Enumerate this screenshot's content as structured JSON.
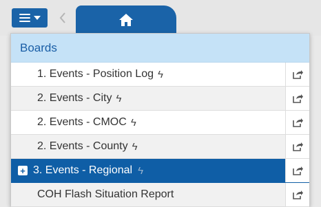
{
  "header": {
    "home_tab": "home"
  },
  "boards": {
    "title": "Boards",
    "items": [
      {
        "label": "1. Events - Position Log",
        "bolt": "ϟ",
        "selected": false
      },
      {
        "label": "2. Events - City",
        "bolt": "ϟ",
        "selected": false
      },
      {
        "label": "2. Events - CMOC",
        "bolt": "ϟ",
        "selected": false
      },
      {
        "label": "2. Events - County",
        "bolt": "ϟ",
        "selected": false
      },
      {
        "label": "3. Events - Regional",
        "bolt": "ϟ",
        "selected": true
      },
      {
        "label": "COH Flash Situation Report",
        "bolt": "",
        "selected": false
      }
    ]
  },
  "colors": {
    "accent": "#1a63a8",
    "header_bg": "#c5e2f7",
    "selected_bg": "#0f5ea6"
  }
}
